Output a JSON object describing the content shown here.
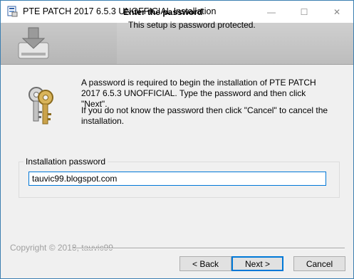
{
  "window": {
    "title": "PTE PATCH 2017 6.5.3 UNOFFICIAL  Installation",
    "controls": {
      "minimize": "—",
      "maximize": "☐",
      "close": "✕"
    }
  },
  "header": {
    "title": "Enter the password",
    "subtitle": "This setup is password protected."
  },
  "body": {
    "paragraph1": "A password is required to begin the installation of PTE PATCH 2017 6.5.3 UNOFFICIAL. Type the password and then click \"Next\".",
    "paragraph2": "If you do not know the password then click \"Cancel\" to cancel the installation.",
    "icon": "keys-icon"
  },
  "password_group": {
    "label": "Installation password",
    "value": "tauvic99.blogspot.com"
  },
  "footer": {
    "copyright": "Copyright © 2018, tauvic99",
    "back_label": "< Back",
    "next_label": "Next >",
    "cancel_label": "Cancel"
  },
  "colors": {
    "focus_border": "#0078d7",
    "header_bg": "#bdbdbd",
    "dialog_bg": "#f0f0f0"
  }
}
